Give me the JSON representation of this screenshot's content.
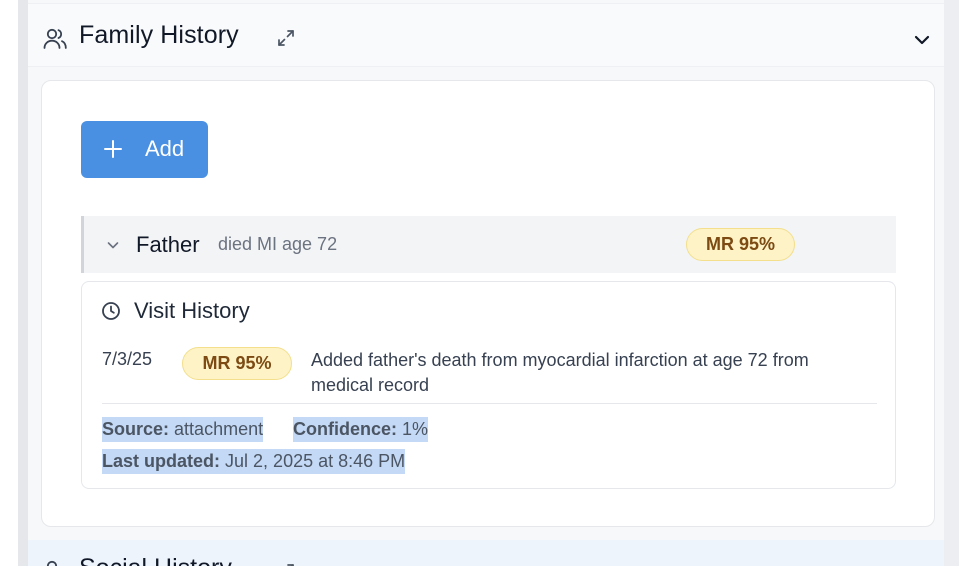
{
  "family_history": {
    "title": "Family History",
    "header_icon": "users-icon",
    "expand_icon": "expand-icon",
    "collapse_icon": "chevron-down-icon",
    "add_button": {
      "label": "Add",
      "icon": "plus-icon",
      "color": "#4a90e2"
    },
    "member": {
      "name": "Father",
      "detail": "died MI age 72",
      "badge": "MR 95%",
      "chevron_icon": "chevron-down-icon"
    },
    "visit_history": {
      "title": "Visit History",
      "icon": "clock-icon",
      "entry": {
        "date": "7/3/25",
        "badge": "MR 95%",
        "text": "Added father's death from myocardial infarction at age 72 from medical record"
      },
      "meta": {
        "source_label": "Source:",
        "source_value": "attachment",
        "confidence_label": "Confidence:",
        "confidence_value": "1%",
        "updated_label": "Last updated:",
        "updated_value": "Jul 2, 2025 at 8:46 PM"
      }
    }
  },
  "next_section": {
    "title": "Social History",
    "icon": "users-icon"
  },
  "colors": {
    "badge_bg": "#fdf3c7",
    "badge_text": "#7c4a12",
    "selection_highlight": "#c4d9f5"
  }
}
